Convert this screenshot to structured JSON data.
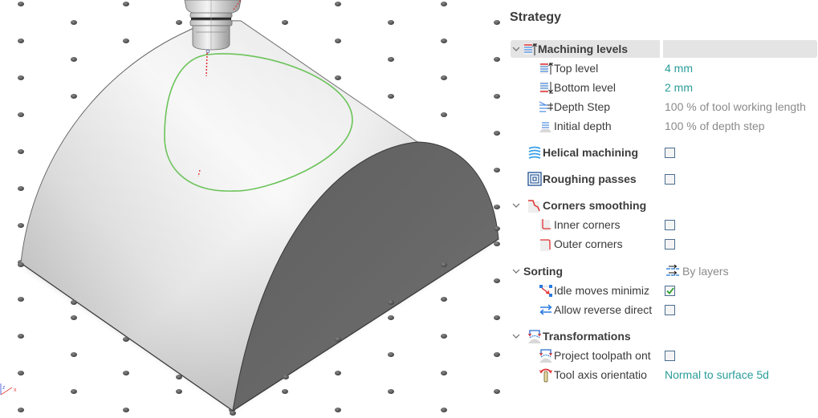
{
  "viewport": {
    "axis_labels": {
      "z": "z",
      "x": "x"
    },
    "colors": {
      "toolpath": "#6cc35a",
      "tool_axis": "#e02020",
      "background": "#ffffff",
      "body_top_light": "#f7f7f7",
      "body_end_face": "#6b6b6b",
      "grid_dot": "#4a4a4a"
    }
  },
  "panel": {
    "title": "Strategy",
    "colors": {
      "value_teal": "#2a9d9a",
      "value_gray": "#8a8a8a",
      "header_bg": "#e4e4e4",
      "check_green": "#2da12d"
    },
    "rows": [
      {
        "id": "machining-levels",
        "label": "Machining levels",
        "bold": true,
        "expandable": true,
        "expanded": true,
        "icon": "machining-levels-icon",
        "value": ""
      },
      {
        "id": "top-level",
        "label": "Top level",
        "icon": "top-level-icon",
        "value": "4 mm",
        "value_style": "teal"
      },
      {
        "id": "bottom-level",
        "label": "Bottom level",
        "icon": "bottom-level-icon",
        "value": "2 mm",
        "value_style": "teal"
      },
      {
        "id": "depth-step",
        "label": "Depth Step",
        "icon": "depth-step-icon",
        "value": "100 % of tool working length",
        "value_style": "gray"
      },
      {
        "id": "initial-depth",
        "label": "Initial depth",
        "icon": "initial-depth-icon",
        "value": "100 % of depth step",
        "value_style": "gray"
      },
      {
        "id": "helical-machining",
        "label": "Helical machining",
        "bold": true,
        "icon": "helical-machining-icon",
        "checkbox": false
      },
      {
        "id": "roughing-passes",
        "label": "Roughing passes",
        "bold": true,
        "icon": "roughing-passes-icon",
        "checkbox": false
      },
      {
        "id": "corners-smoothing",
        "label": "Corners smoothing",
        "bold": true,
        "expandable": true,
        "expanded": true,
        "icon": "corners-smoothing-icon"
      },
      {
        "id": "inner-corners",
        "label": "Inner corners",
        "icon": "inner-corners-icon",
        "checkbox": false
      },
      {
        "id": "outer-corners",
        "label": "Outer corners",
        "icon": "outer-corners-icon",
        "checkbox": false
      },
      {
        "id": "sorting",
        "label": "Sorting",
        "bold": true,
        "expandable": true,
        "expanded": true,
        "value": "By layers",
        "value_icon": "by-layers-icon",
        "value_style": "gray"
      },
      {
        "id": "idle-moves",
        "label": "Idle moves minimiz",
        "icon": "idle-moves-icon",
        "checkbox": true
      },
      {
        "id": "allow-reverse",
        "label": "Allow reverse direct",
        "icon": "allow-reverse-icon",
        "checkbox": false
      },
      {
        "id": "transformations",
        "label": "Transformations",
        "bold": true,
        "expandable": true,
        "expanded": true,
        "icon": "transformations-icon"
      },
      {
        "id": "project-toolpath",
        "label": "Project toolpath ont",
        "icon": "project-toolpath-icon",
        "checkbox": false
      },
      {
        "id": "tool-axis-orientation",
        "label": "Tool axis orientatio",
        "icon": "tool-axis-orientation-icon",
        "value": "Normal to surface 5d",
        "value_style": "teal"
      }
    ]
  }
}
